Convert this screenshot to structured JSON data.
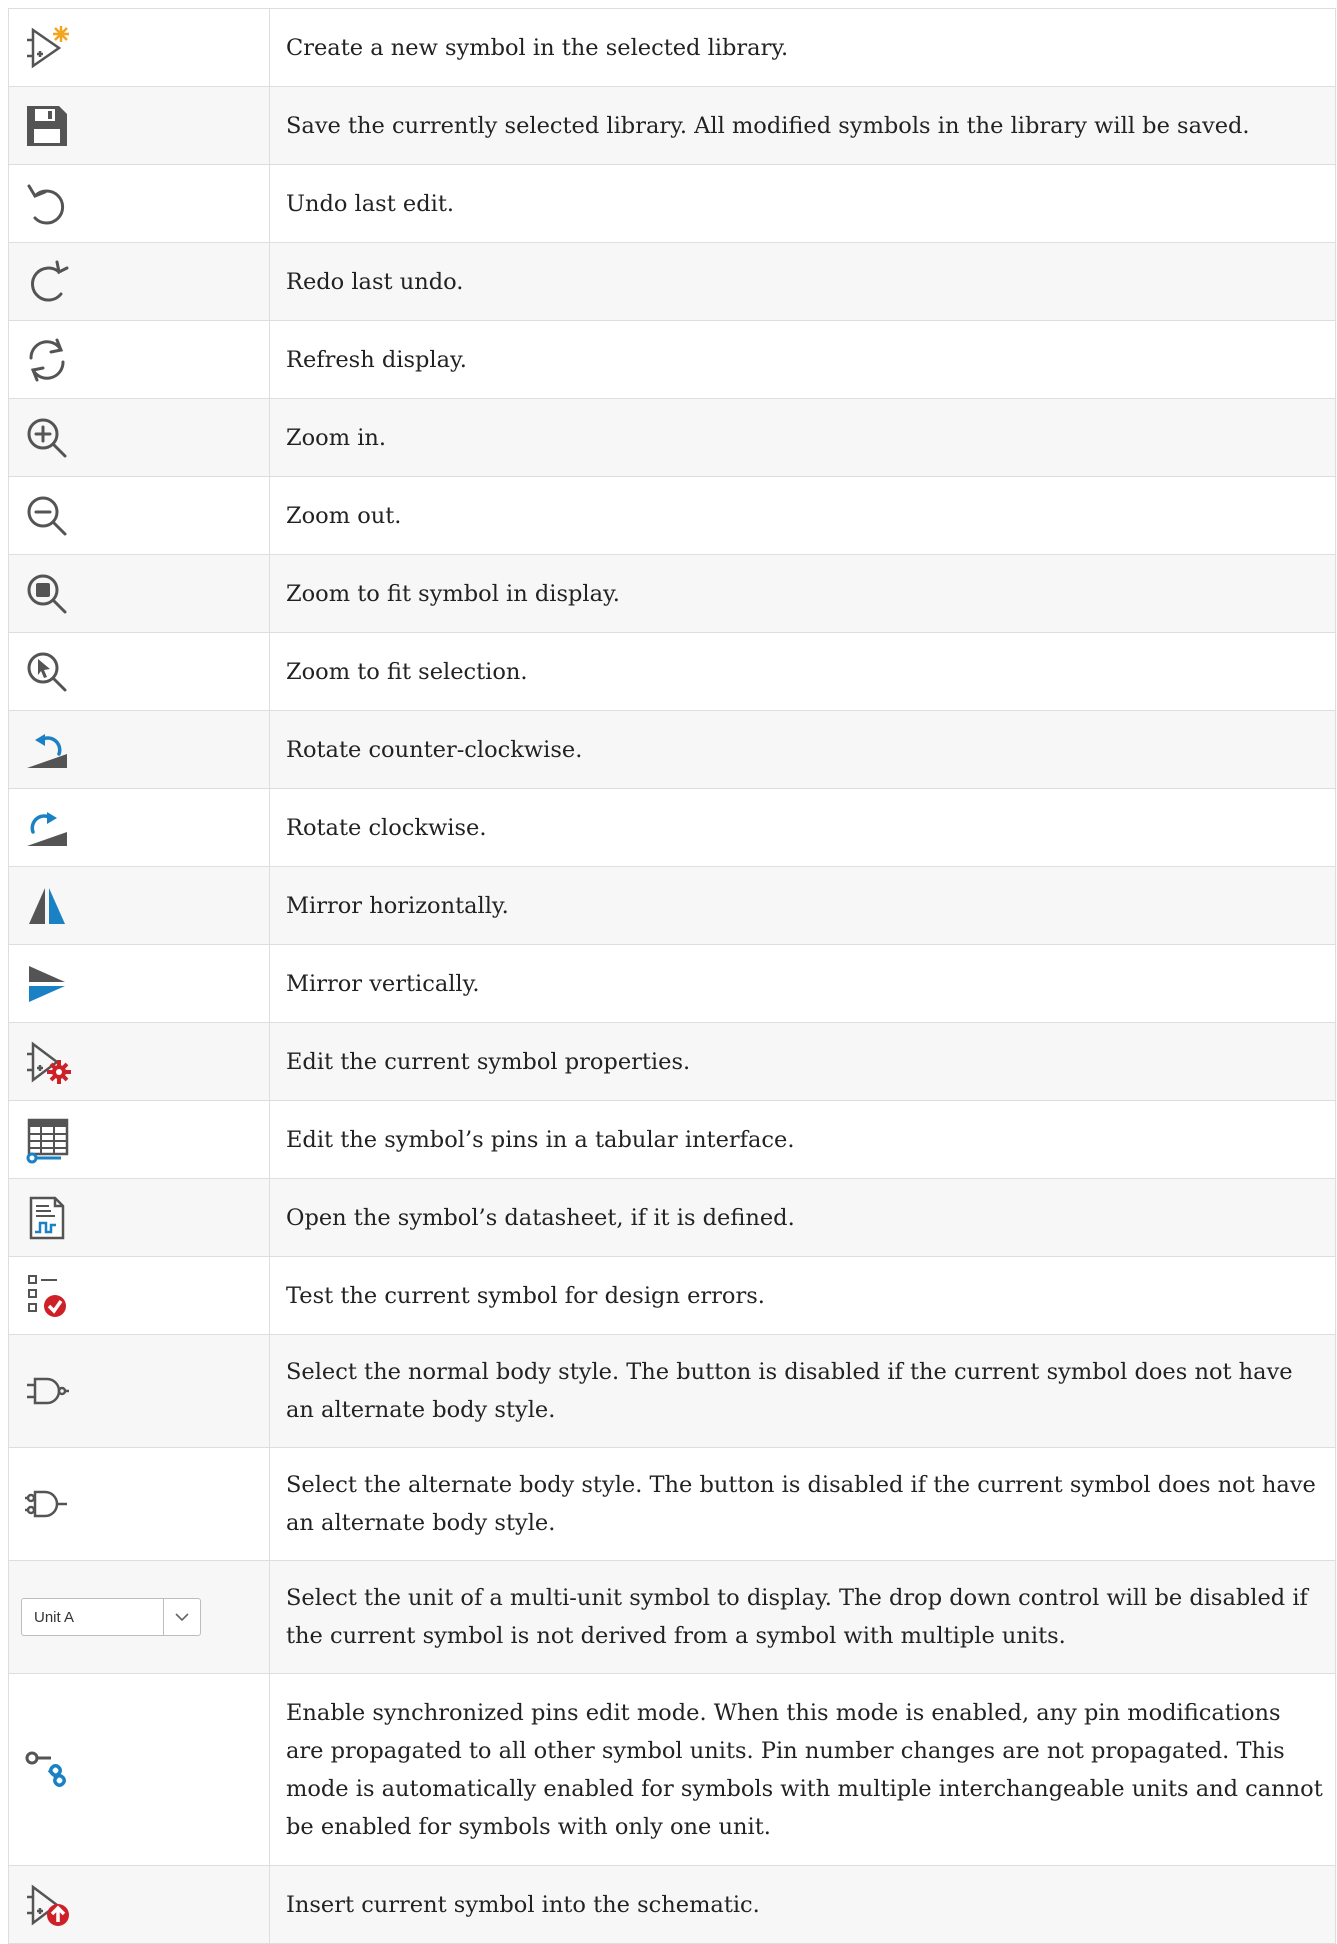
{
  "colors": {
    "icon_gray": "#545454",
    "icon_blue": "#1a81c4",
    "icon_red": "#cf2028",
    "icon_orange": "#f3a51e",
    "row_alt": "#f7f7f8",
    "border": "#dedede"
  },
  "rows": [
    {
      "icon": "new-symbol-icon",
      "text": "Create a new symbol in the selected library."
    },
    {
      "icon": "save-icon",
      "text": "Save the currently selected library. All modified symbols in the library will be saved."
    },
    {
      "icon": "undo-icon",
      "text": "Undo last edit."
    },
    {
      "icon": "redo-icon",
      "text": "Redo last undo."
    },
    {
      "icon": "refresh-icon",
      "text": "Refresh display."
    },
    {
      "icon": "zoom-in-icon",
      "text": "Zoom in."
    },
    {
      "icon": "zoom-out-icon",
      "text": "Zoom out."
    },
    {
      "icon": "zoom-fit-icon",
      "text": "Zoom to fit symbol in display."
    },
    {
      "icon": "zoom-selection-icon",
      "text": "Zoom to fit selection."
    },
    {
      "icon": "rotate-ccw-icon",
      "text": "Rotate counter-clockwise."
    },
    {
      "icon": "rotate-cw-icon",
      "text": "Rotate clockwise."
    },
    {
      "icon": "mirror-horizontal-icon",
      "text": "Mirror horizontally."
    },
    {
      "icon": "mirror-vertical-icon",
      "text": "Mirror vertically."
    },
    {
      "icon": "symbol-properties-icon",
      "text": "Edit the current symbol properties."
    },
    {
      "icon": "pin-table-icon",
      "text": "Edit the symbol’s pins in a tabular interface."
    },
    {
      "icon": "datasheet-icon",
      "text": "Open the symbol’s datasheet, if it is defined."
    },
    {
      "icon": "check-errors-icon",
      "text": "Test the current symbol for design errors."
    },
    {
      "icon": "normal-body-style-icon",
      "text": "Select the normal body style. The button is disabled if the current symbol does not have an alternate body style."
    },
    {
      "icon": "alternate-body-style-icon",
      "text": "Select the alternate body style. The button is disabled if the current symbol does not have an alternate body style."
    },
    {
      "icon": "unit-dropdown",
      "text": "Select the unit of a multi-unit symbol to display. The drop down control will be disabled if the current symbol is not derived from a symbol with multiple units."
    },
    {
      "icon": "sync-pins-icon",
      "text": "Enable synchronized pins edit mode. When this mode is enabled, any pin modifications are propagated to all other symbol units. Pin number changes are not propagated. This mode is automatically enabled for symbols with multiple interchangeable units and cannot be enabled for symbols with only one unit."
    },
    {
      "icon": "insert-symbol-icon",
      "text": "Insert current symbol into the schematic."
    }
  ],
  "unit_select": {
    "value": "Unit A"
  }
}
